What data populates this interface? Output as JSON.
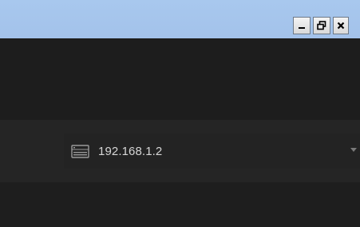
{
  "window_controls": {
    "minimize": "_",
    "restore": "🗗",
    "close": "✕"
  },
  "device_selector": {
    "icon": "network-device-icon",
    "selected": "192.168.1.2"
  },
  "colors": {
    "titlebar": "#a8c8ee",
    "background": "#1f1f1f",
    "selector_bg": "#232323",
    "text": "#d6d6d6"
  }
}
